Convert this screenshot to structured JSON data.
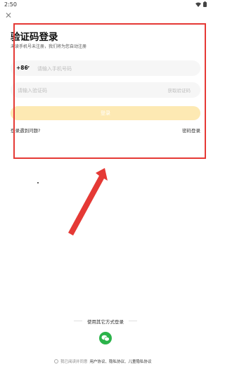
{
  "status_bar": {
    "time": "2:50"
  },
  "icons": {
    "close": "close-icon",
    "wifi": "wifi-icon",
    "battery": "battery-icon",
    "chevron": "chevron-down-icon",
    "wechat": "wechat-icon",
    "arrow": "red-annotation-arrow"
  },
  "login": {
    "title": "验证码登录",
    "subtitle": "未读手机号未注册，我们将为您自动注册",
    "country_code": "+86",
    "phone_placeholder": "请输入手机号码",
    "code_placeholder": "请输入验证码",
    "get_code_label": "获取验证码",
    "login_button": "登录",
    "problem_link": "登录遇到问题?",
    "password_login_link": "密码登录"
  },
  "other_login": {
    "label": "使用其它方式登录"
  },
  "agreement": {
    "prefix": "我已阅读并同意",
    "links": "用户协议、隐私协议、儿童隐私协议"
  },
  "colors": {
    "highlight": "#e53935",
    "login_button": "#fde9b3",
    "field_bg": "#f6f6f6",
    "wechat": "#2bb34a"
  }
}
